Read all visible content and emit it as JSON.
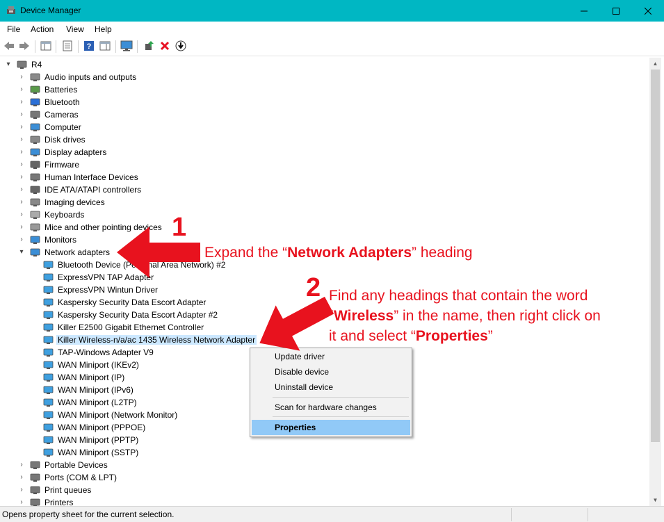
{
  "window": {
    "title": "Device Manager"
  },
  "menu": [
    "File",
    "Action",
    "View",
    "Help"
  ],
  "tree": {
    "root": "R4",
    "categories_before": [
      {
        "label": "Audio inputs and outputs",
        "icon": "speaker-icon"
      },
      {
        "label": "Batteries",
        "icon": "battery-icon"
      },
      {
        "label": "Bluetooth",
        "icon": "bluetooth-icon"
      },
      {
        "label": "Cameras",
        "icon": "camera-icon"
      },
      {
        "label": "Computer",
        "icon": "computer-icon"
      },
      {
        "label": "Disk drives",
        "icon": "disk-drive-icon"
      },
      {
        "label": "Display adapters",
        "icon": "display-adapter-icon"
      },
      {
        "label": "Firmware",
        "icon": "firmware-icon"
      },
      {
        "label": "Human Interface Devices",
        "icon": "hid-icon"
      },
      {
        "label": "IDE ATA/ATAPI controllers",
        "icon": "ide-controller-icon"
      },
      {
        "label": "Imaging devices",
        "icon": "imaging-device-icon"
      },
      {
        "label": "Keyboards",
        "icon": "keyboard-icon"
      },
      {
        "label": "Mice and other pointing devices",
        "icon": "mouse-icon"
      },
      {
        "label": "Monitors",
        "icon": "monitor-icon"
      }
    ],
    "expanded_category": {
      "label": "Network adapters",
      "icon": "network-adapter-icon"
    },
    "network_adapters": [
      "Bluetooth Device (Personal Area Network) #2",
      "ExpressVPN TAP Adapter",
      "ExpressVPN Wintun Driver",
      "Kaspersky Security Data Escort Adapter",
      "Kaspersky Security Data Escort Adapter #2",
      "Killer E2500 Gigabit Ethernet Controller",
      "Killer Wireless-n/a/ac 1435 Wireless Network Adapter",
      "TAP-Windows Adapter V9",
      "WAN Miniport (IKEv2)",
      "WAN Miniport (IP)",
      "WAN Miniport (IPv6)",
      "WAN Miniport (L2TP)",
      "WAN Miniport (Network Monitor)",
      "WAN Miniport (PPPOE)",
      "WAN Miniport (PPTP)",
      "WAN Miniport (SSTP)"
    ],
    "selected_adapter_index": 6,
    "categories_after": [
      {
        "label": "Portable Devices",
        "icon": "portable-device-icon"
      },
      {
        "label": "Ports (COM & LPT)",
        "icon": "port-icon"
      },
      {
        "label": "Print queues",
        "icon": "printer-icon"
      },
      {
        "label": "Printers",
        "icon": "printer-icon"
      }
    ]
  },
  "context_menu": {
    "items": [
      "Update driver",
      "Disable device",
      "Uninstall device",
      "Scan for hardware changes",
      "Properties"
    ],
    "highlighted": "Properties"
  },
  "status": "Opens property sheet for the current selection.",
  "annotations": {
    "step1_number": "1",
    "step1_pre": "Expand the “",
    "step1_bold": "Network Adapters",
    "step1_post": "” heading",
    "step2_number": "2",
    "step2_line1": "Find any headings that contain the word",
    "step2_line2_pre": "“",
    "step2_line2_bold": "Wireless",
    "step2_line2_post": "” in the name, then right click on",
    "step2_line3_pre": "it and select “",
    "step2_line3_bold": "Properties",
    "step2_line3_post": "”",
    "color": "#e8121e"
  }
}
